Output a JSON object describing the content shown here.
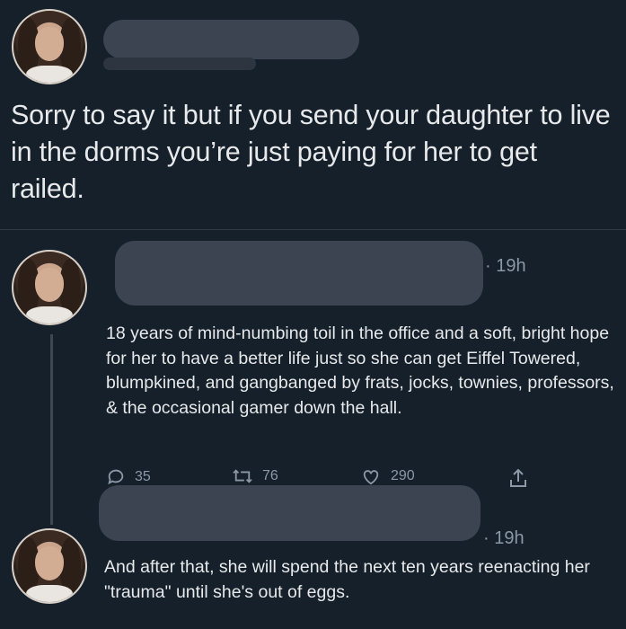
{
  "tweet_main": {
    "text": "Sorry to say it but if you send your daughter to live in the dorms you’re just paying for her to get railed."
  },
  "reply_1": {
    "time": "· 19h",
    "text": "18 years of mind-numbing toil in the office and a soft, bright hope for her to have a better life just so she can get Eiffel Towered, blumpkined, and gangbanged by frats, jocks, townies, professors, & the occasional gamer down the hall.",
    "replies": "35",
    "retweets": "76",
    "likes": "290"
  },
  "reply_2": {
    "time": "· 19h",
    "text": "And after that, she will spend the next ten years reenacting her \"trauma\" until she's out of eggs."
  },
  "icons": {
    "reply": "reply-icon",
    "retweet": "retweet-icon",
    "like": "heart-icon",
    "share": "share-icon"
  },
  "colors": {
    "background": "#15202b",
    "text": "#e7e9ea",
    "secondary": "#8b98a5"
  }
}
